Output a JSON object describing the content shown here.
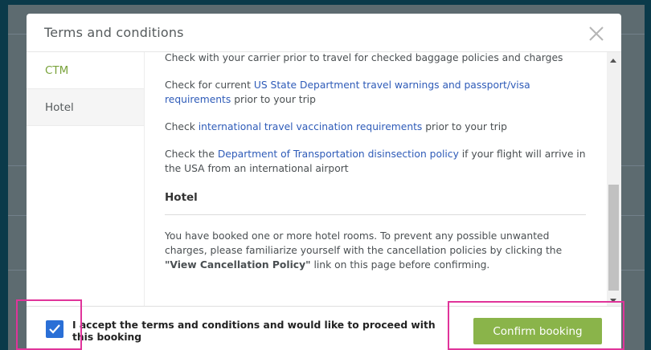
{
  "modal": {
    "title": "Terms and conditions"
  },
  "tabs": [
    {
      "label": "CTM",
      "active": true
    },
    {
      "label": "Hotel",
      "active": false
    }
  ],
  "content": {
    "p1": "Check with your carrier prior to travel for checked baggage policies and charges",
    "p2_pre": "Check for current ",
    "p2_link": "US State Department travel warnings and passport/visa requirements",
    "p2_post": " prior to your trip",
    "p3_pre": "Check ",
    "p3_link": "international travel vaccination requirements",
    "p3_post": " prior to your trip",
    "p4_pre": "Check the ",
    "p4_link": "Department of Transportation disinsection policy",
    "p4_post": " if your flight will arrive in the USA from an international airport",
    "hotel_title": "Hotel",
    "hotel_text": "You have booked one or more hotel rooms. To prevent any possible unwanted charges, please familiarize yourself with the cancellation policies by clicking the ",
    "hotel_bold": "\"View Cancellation Policy\"",
    "hotel_text_post": " link on this page before confirming."
  },
  "footer": {
    "accept_label": "I accept the terms and conditions and would like to proceed with this booking",
    "accept_checked": true,
    "confirm_label": "Confirm booking"
  },
  "colors": {
    "accent_green": "#8ab44a",
    "tab_active": "#7aa33c",
    "link": "#2e5bb8",
    "checkbox": "#2a6fd6",
    "highlight": "#e0349a"
  }
}
